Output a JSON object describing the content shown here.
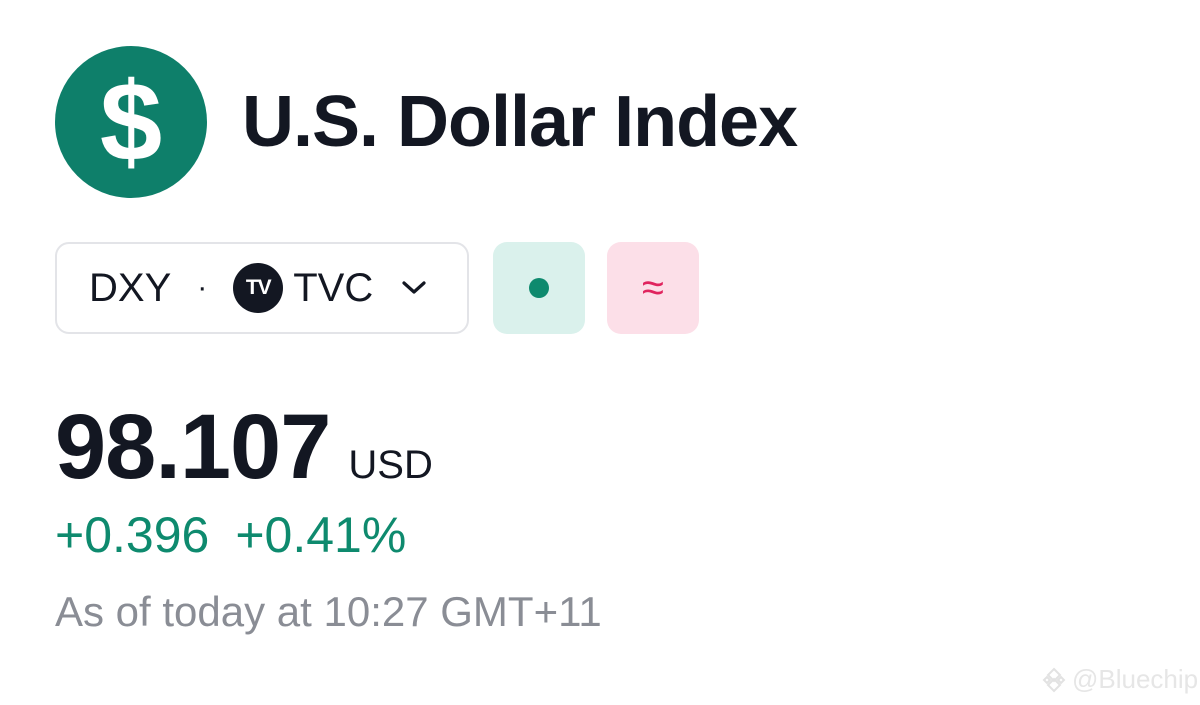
{
  "header": {
    "logo_symbol": "$",
    "title": "U.S. Dollar Index"
  },
  "symbol_selector": {
    "ticker": "DXY",
    "separator": "·",
    "exchange_badge": "TV",
    "exchange": "TVC"
  },
  "status": {
    "market_dot_color": "#0e8a6e",
    "delayed_symbol": "≈"
  },
  "quote": {
    "price": "98.107",
    "currency": "USD",
    "change": "+0.396",
    "change_percent": "+0.41%",
    "as_of": "As of today at 10:27 GMT+11"
  },
  "watermark": {
    "text": "@Bluechip"
  },
  "colors": {
    "brand_green": "#0e7f6a",
    "positive": "#0e8a6e",
    "delayed_pink": "#e0245e"
  }
}
